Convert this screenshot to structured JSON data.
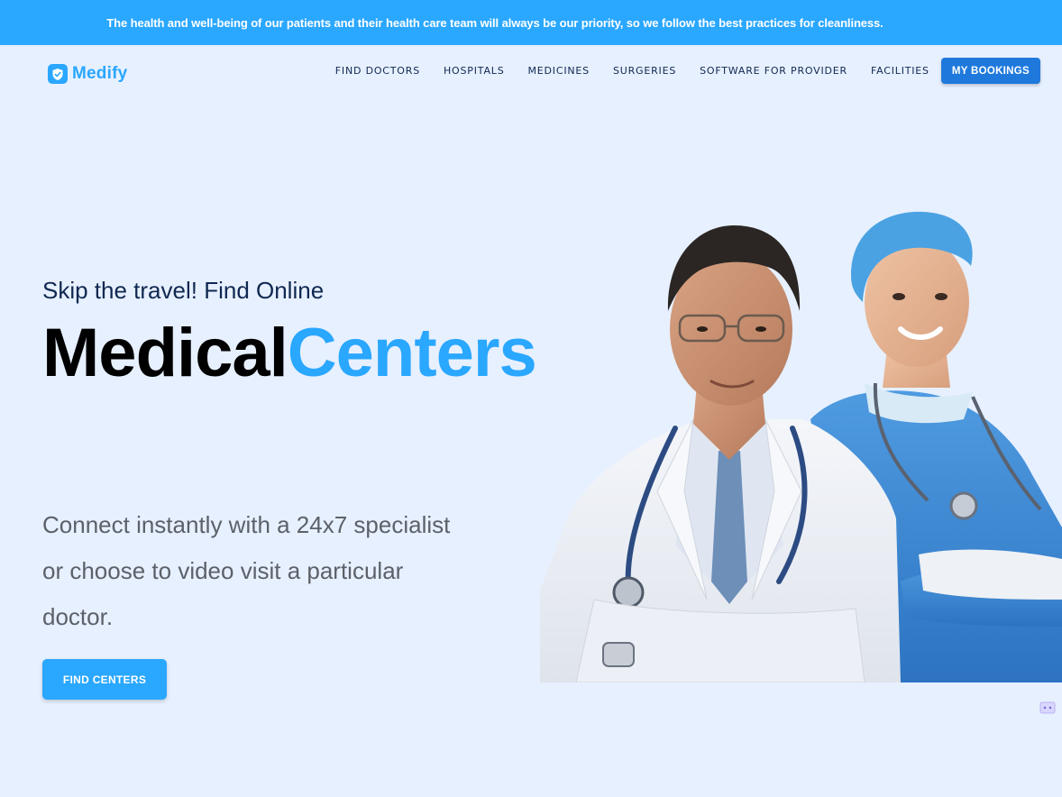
{
  "announcement": "The health and well-being of our patients and their health care team will always be our priority, so we follow the best practices for cleanliness.",
  "brand": {
    "name": "Medify",
    "color": "#2aa7ff",
    "icon": "shield-check-icon"
  },
  "nav": {
    "links": [
      "Find Doctors",
      "Hospitals",
      "Medicines",
      "Surgeries",
      "Software for Provider",
      "Facilities"
    ],
    "cta": "My Bookings"
  },
  "hero": {
    "subtitle": "Skip the travel! Find Online",
    "title_dark": "Medical",
    "title_accent": "Centers",
    "description": "Connect instantly with a 24x7 specialist or choose to video visit a particular doctor.",
    "button": "Find Centers",
    "image": "doctor-and-nurse-photo"
  },
  "colors": {
    "accent": "#2aa7ff",
    "cta_dark": "#1f79dc",
    "background": "#e7f0ff",
    "heading": "#102851"
  }
}
